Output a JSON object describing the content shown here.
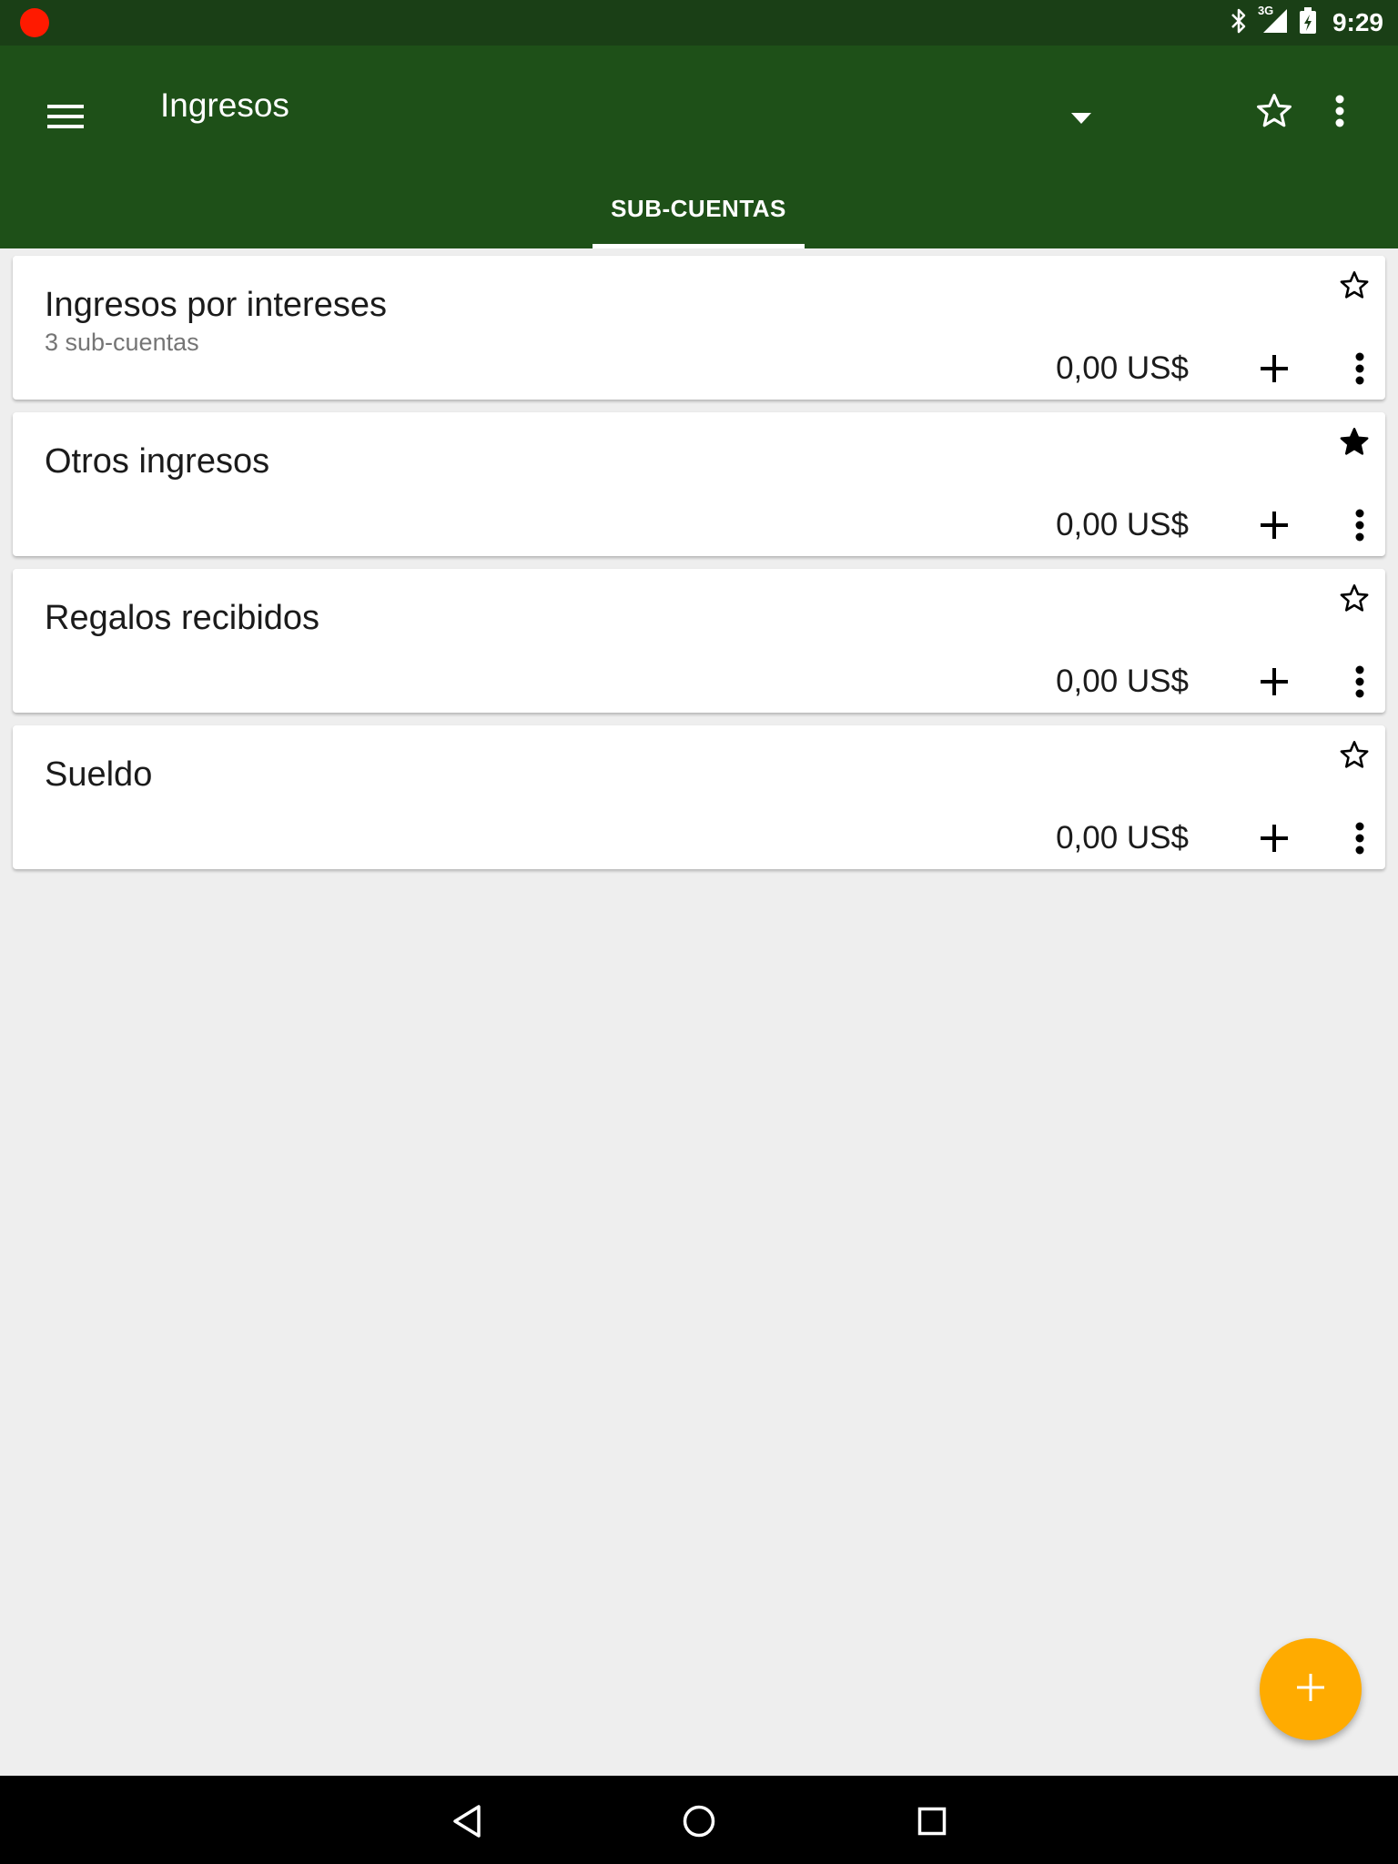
{
  "status_bar": {
    "time": "9:29",
    "network": "3G",
    "icons": [
      "recording-dot-icon",
      "bluetooth-icon",
      "signal-icon",
      "battery-charging-icon"
    ]
  },
  "app_bar": {
    "title": "Ingresos",
    "menu_icon": "hamburger-menu-icon",
    "dropdown_icon": "dropdown-arrow-icon",
    "favorite_icon": "star-outline-icon",
    "more_icon": "more-vert-icon",
    "background_color": "#1e5018"
  },
  "tabs": [
    {
      "label": "SUB-CUENTAS",
      "selected": true
    }
  ],
  "accounts": [
    {
      "name": "Ingresos por intereses",
      "subtitle": "3 sub-cuentas",
      "balance": "0,00 US$",
      "favorite": false
    },
    {
      "name": "Otros ingresos",
      "subtitle": "",
      "balance": "0,00 US$",
      "favorite": true
    },
    {
      "name": "Regalos recibidos",
      "subtitle": "",
      "balance": "0,00 US$",
      "favorite": false
    },
    {
      "name": "Sueldo",
      "subtitle": "",
      "balance": "0,00 US$",
      "favorite": false
    }
  ],
  "fab": {
    "icon": "plus-icon",
    "color": "#ffab00"
  },
  "nav_bar": {
    "icons": [
      "back-icon",
      "home-icon",
      "recents-icon"
    ]
  }
}
